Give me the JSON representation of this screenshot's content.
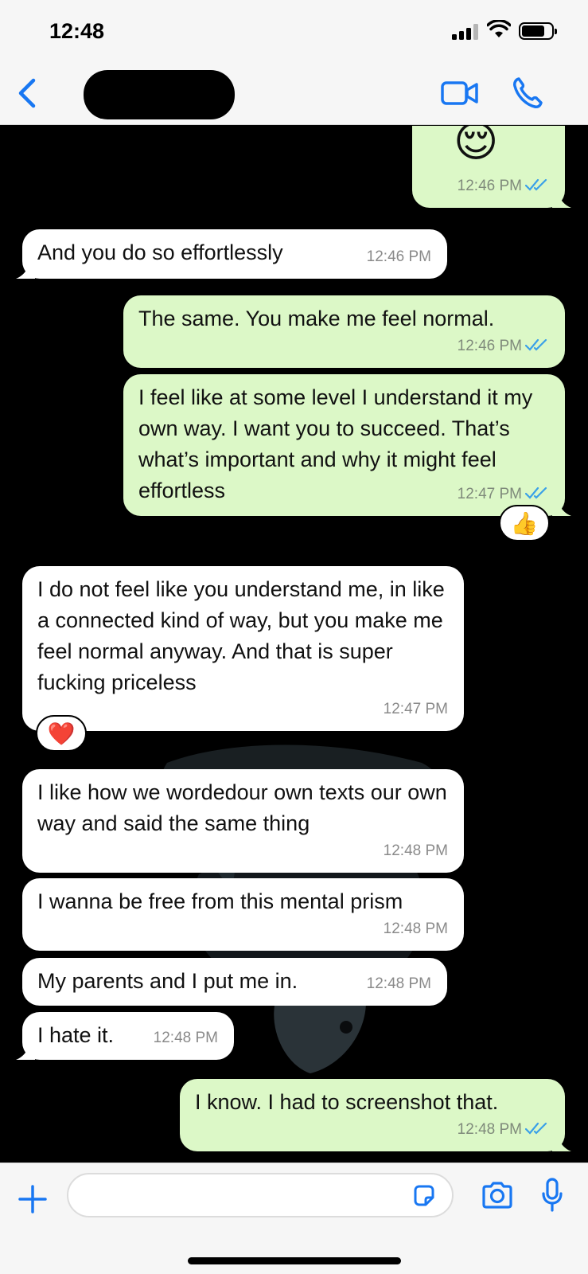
{
  "status_bar": {
    "time": "12:48"
  },
  "header": {
    "contact_name": ""
  },
  "messages": [
    {
      "direction": "out",
      "text": "",
      "emoji": "😌",
      "time": "12:46 PM",
      "read": true
    },
    {
      "direction": "in",
      "text": "And you do so effortlessly",
      "time": "12:46 PM"
    },
    {
      "direction": "out",
      "text": "The same. You make me feel normal.",
      "time": "12:46 PM",
      "read": true
    },
    {
      "direction": "out",
      "text": "I feel like at some level I understand it my own way. I want you to succeed. That’s what’s important and why it might feel effortless",
      "time": "12:47 PM",
      "read": true,
      "reaction": "👍"
    },
    {
      "direction": "in",
      "text": "I do not feel like you understand me, in like a connected kind of way, but you make me feel normal anyway. And that is super fucking priceless",
      "time": "12:47 PM",
      "reaction": "❤️"
    },
    {
      "direction": "in",
      "text": "I like how we wordedour own texts our own way and said the same thing",
      "time": "12:48 PM"
    },
    {
      "direction": "in",
      "text": "I wanna be free from this mental prism",
      "time": "12:48 PM"
    },
    {
      "direction": "in",
      "text": "My parents and I put me in.",
      "time": "12:48 PM"
    },
    {
      "direction": "in",
      "text": "I hate it.",
      "time": "12:48 PM"
    },
    {
      "direction": "out",
      "text": "I know. I had to screenshot that.",
      "time": "12:48 PM",
      "read": true
    }
  ],
  "composer": {
    "placeholder": ""
  },
  "colors": {
    "accent": "#1877f2",
    "outgoing": "#dcf8c7",
    "incoming": "#ffffff",
    "read_ticks": "#3aa0e8",
    "background": "#000000"
  }
}
